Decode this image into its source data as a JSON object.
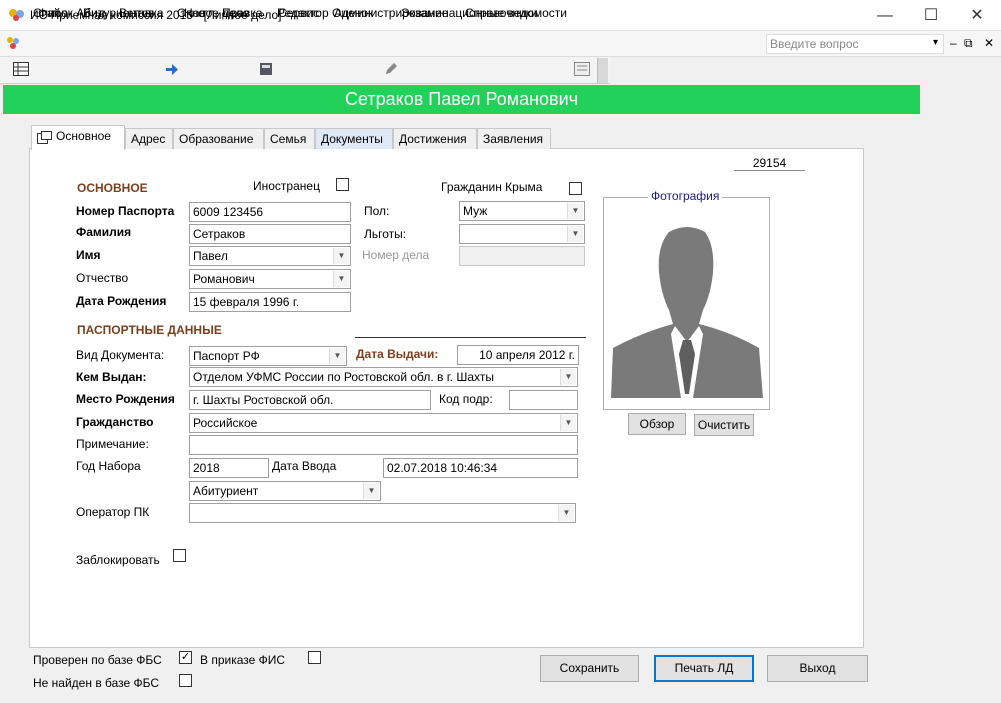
{
  "window": {
    "title": "ИС Приемная комиссия 2015 - [Личное дело]",
    "minimize": "—",
    "maximize": "☐",
    "close": "✕"
  },
  "menu": {
    "items": [
      "Файл",
      "Вид",
      "Вставка",
      "Окно",
      "Правка",
      "Сервис",
      "Администрирование",
      "Справочники"
    ],
    "help_placeholder": "Введите вопрос",
    "help_arrow": "▾",
    "doc_min": "–",
    "doc_restore": "⧉",
    "doc_close": "✕"
  },
  "toolbar": {
    "items": [
      "Список Абитуриентов",
      "Новое дело",
      "Редактор Оценок",
      "Экзаменационные ведомости"
    ]
  },
  "header": {
    "name": "Сетраков Павел Романович"
  },
  "tabs": [
    "Основное",
    "Адрес",
    "Образование",
    "Семья",
    "Документы",
    "Достижения",
    "Заявления"
  ],
  "record_number": "29154",
  "basic": {
    "section_title": "ОСНОВНОЕ",
    "foreigner_label": "Иностранец",
    "crimea_label": "Гражданин Крыма",
    "passport_label": "Номер Паспорта",
    "passport_value": "6009 123456",
    "lastname_label": "Фамилия",
    "lastname_value": "Сетраков",
    "firstname_label": "Имя",
    "firstname_value": "Павел",
    "patronymic_label": "Отчество",
    "patronymic_value": "Романович",
    "birthdate_label": "Дата Рождения",
    "birthdate_value": "15 февраля 1996 г.",
    "gender_label": "Пол:",
    "gender_value": "Муж",
    "benefits_label": "Льготы:",
    "benefits_value": "",
    "case_label": "Номер дела",
    "case_value": ""
  },
  "passport": {
    "section_title": "ПАСПОРТНЫЕ ДАННЫЕ",
    "doctype_label": "Вид Документа:",
    "doctype_value": "Паспорт РФ",
    "issue_date_label": "Дата Выдачи:",
    "issue_date_value": "10 апреля 2012 г.",
    "issued_by_label": "Кем Выдан:",
    "issued_by_value": "Отделом УФМС России по Ростовской обл. в г. Шахты",
    "birthplace_label": "Место Рождения",
    "birthplace_value": "г. Шахты Ростовской обл.",
    "code_label": "Код подр:",
    "code_value": "",
    "citizenship_label": "Гражданство",
    "citizenship_value": "Российское",
    "note_label": "Примечание:",
    "note_value": "",
    "year_label": "Год Набора",
    "year_value": "2018",
    "entry_date_label": "Дата Ввода",
    "entry_date_value": "02.07.2018 10:46:34",
    "status_value": "Абитуриент",
    "operator_label": "Оператор ПК",
    "operator_value": "",
    "block_label": "Заблокировать"
  },
  "photo": {
    "title": "Фотография",
    "browse": "Обзор",
    "clear": "Очистить"
  },
  "footer": {
    "fbs_checked_label": "Проверен по базе ФБС",
    "fbs_checked": "✓",
    "fis_label": "В приказе ФИС",
    "fbs_notfound_label": "Не найден в базе ФБС",
    "save": "Сохранить",
    "print": "Печать ЛД",
    "exit": "Выход"
  },
  "colors": {
    "header_bg": "#21d15a",
    "section": "#7b3f1e",
    "accent": "#0078d7"
  }
}
